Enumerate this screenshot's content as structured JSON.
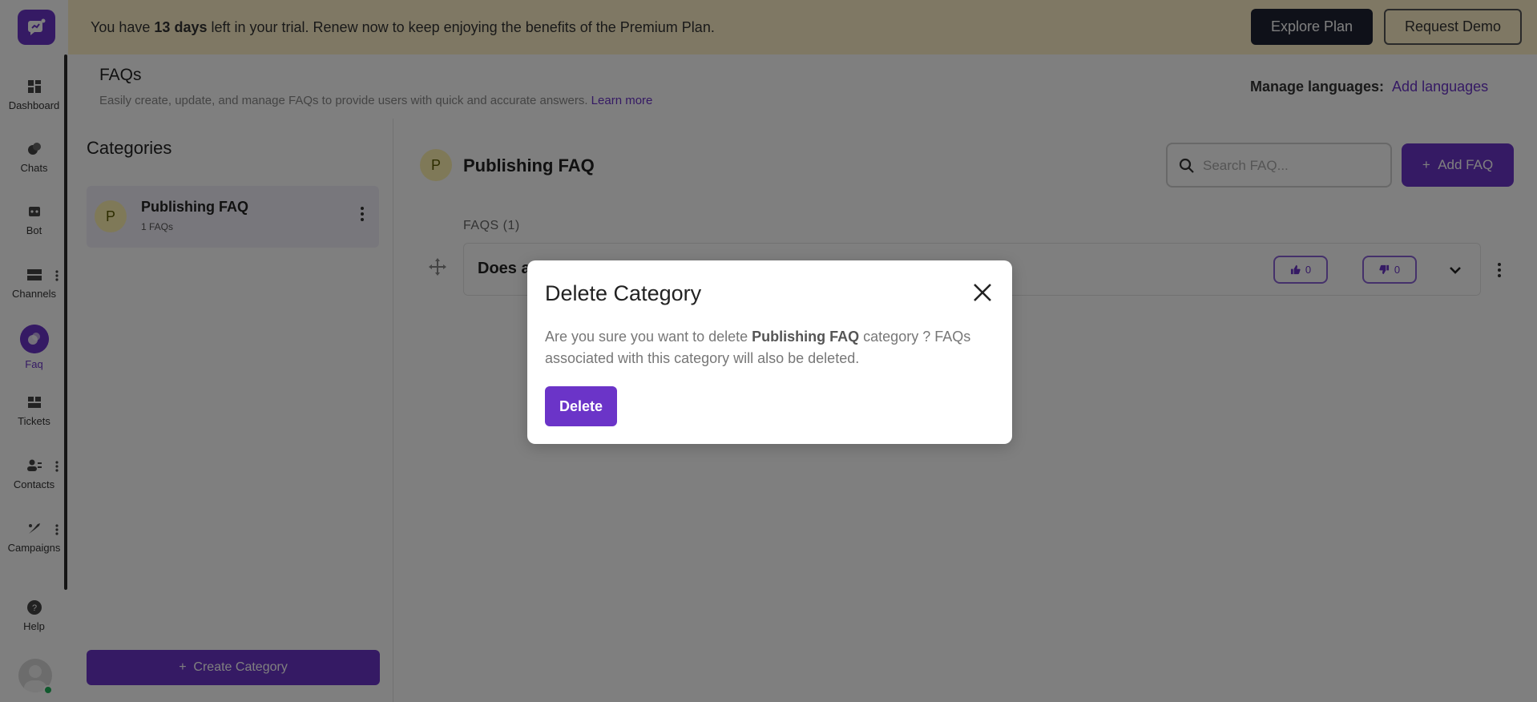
{
  "colors": {
    "accent": "#6b34c8",
    "banner_bg": "#fff1c9",
    "dark_button": "#1f2333",
    "badge_bg": "#fff3b0",
    "online": "#21b35a"
  },
  "banner": {
    "text_before": "You have ",
    "days": "13 days",
    "text_after": " left in your trial. Renew now to keep enjoying the benefits of the Premium Plan.",
    "explore_label": "Explore Plan",
    "demo_label": "Request Demo"
  },
  "sidebar": {
    "items": [
      {
        "label": "Dashboard",
        "icon": "dashboard-icon"
      },
      {
        "label": "Chats",
        "icon": "chats-icon"
      },
      {
        "label": "Bot",
        "icon": "bot-icon"
      },
      {
        "label": "Channels",
        "icon": "channels-icon"
      },
      {
        "label": "Faq",
        "icon": "faq-icon",
        "active": true
      },
      {
        "label": "Tickets",
        "icon": "tickets-icon"
      },
      {
        "label": "Contacts",
        "icon": "contacts-icon"
      },
      {
        "label": "Campaigns",
        "icon": "campaigns-icon"
      },
      {
        "label": "Help",
        "icon": "help-icon"
      }
    ]
  },
  "header": {
    "title": "FAQs",
    "subtitle": "Easily create, update, and manage FAQs to provide users with quick and accurate answers.",
    "learn_more": "Learn more",
    "manage_languages_label": "Manage languages:",
    "add_languages": "Add languages"
  },
  "categories": {
    "title": "Categories",
    "items": [
      {
        "initial": "P",
        "name": "Publishing FAQ",
        "count": "1 FAQs"
      }
    ],
    "create_label": "Create Category"
  },
  "main": {
    "category_initial": "P",
    "category_title": "Publishing FAQ",
    "search_placeholder": "Search FAQ...",
    "add_faq_label": "Add FAQ",
    "faqs_label": "FAQS (1)",
    "faq_rows": [
      {
        "question": "Does a",
        "upvotes": "0",
        "downvotes": "0"
      }
    ]
  },
  "modal": {
    "title": "Delete Category",
    "body_before": "Are you sure you want to delete ",
    "body_bold": "Publishing FAQ",
    "body_after": " category ? FAQs associated with this category will also be deleted.",
    "delete_label": "Delete"
  }
}
